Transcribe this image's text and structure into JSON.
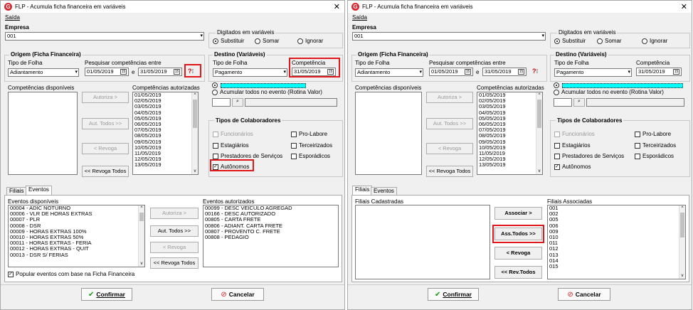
{
  "title": "FLP - Acumula ficha financeira em variáveis",
  "menu_saida": "Saída",
  "empresa_label": "Empresa",
  "empresa_value": "001",
  "digitados": {
    "label": "Digitados em variáveis",
    "substituir": "Substituir",
    "somar": "Somar",
    "ignorar": "Ignorar"
  },
  "origem": {
    "label": "Origem (Ficha Financeira)",
    "tipo_label": "Tipo de Folha",
    "tipo_value": "Adiantamento",
    "pesquisar_label": "Pesquisar competências entre",
    "data_ini": "01/05/2019",
    "e": "e",
    "data_fim": "31/05/2019",
    "help": "?"
  },
  "destino": {
    "label": "Destino (Variáveis)",
    "tipo_label": "Tipo de Folha",
    "tipo_value": "Pagamento",
    "comp_label": "Competência",
    "comp_value": "31/05/2019",
    "acumular": "Acumular todos no evento (Rotina Valor)"
  },
  "comp_disp_label": "Competências disponíveis",
  "comp_aut_label": "Competências autorizadas",
  "comp_aut": [
    "01/05/2019",
    "02/05/2019",
    "03/05/2019",
    "04/05/2019",
    "05/05/2019",
    "06/05/2019",
    "07/05/2019",
    "08/05/2019",
    "09/05/2019",
    "10/05/2019",
    "11/05/2019",
    "12/05/2019",
    "13/05/2019"
  ],
  "btn": {
    "autoriza": "Autoriza >",
    "aut_todos": "Aut. Todos >>",
    "revoga": "< Revoga",
    "revoga_todos": "<< Revoga Todos"
  },
  "tipos": {
    "label": "Tipos de Colaboradores",
    "funcionarios": "Funcionários",
    "pro_labore": "Pro-Labore",
    "estagiarios": "Estagiários",
    "terceirizados": "Terceirizados",
    "prestadores": "Prestadores de Serviços",
    "esporadicos": "Esporádicos",
    "autonomos": "Autônomos"
  },
  "tabs": {
    "filiais": "Filiais",
    "eventos": "Eventos"
  },
  "eventos_disp_label": "Eventos disponíveis",
  "eventos_disp": [
    "00004 - ADIC NOTURNO",
    "00006 - VLR DE HORAS EXTRAS",
    "00007 - PLR",
    "00008 - DSR",
    "00009 - HORAS EXTRAS 100%",
    "00010 - HORAS EXTRAS 50%",
    "00011 - HORAS EXTRAS - FERIA",
    "00012 - HORAS EXTRAS - QUIT",
    "00013 - DSR S/ FERIAS"
  ],
  "eventos_aut_label": "Eventos autorizados",
  "eventos_aut": [
    "00099 - DESC VEICULO AGREGAD",
    "00166 - DESC AUTORIZADO",
    "00805 - CARTA FRETE",
    "00806 - ADIANT. CARTA FRETE",
    "00807 - PROVENTO C. FRETE",
    "00808 - PEDAGIO"
  ],
  "popular": "Popular eventos com base na Ficha Financeira",
  "filiais_cad_label": "Filiais Cadastradas",
  "filiais_assoc_label": "Filiais Associadas",
  "filiais_assoc": [
    "001",
    "002",
    "005",
    "006",
    "009",
    "010",
    "011",
    "012",
    "013",
    "014",
    "015"
  ],
  "fbtn": {
    "associar": "Associar >",
    "ass_todos": "Ass.Todos >>",
    "revoga": "< Revoga",
    "rev_todos": "<< Rev.Todos"
  },
  "confirmar": "Confirmar",
  "cancelar": "Cancelar"
}
